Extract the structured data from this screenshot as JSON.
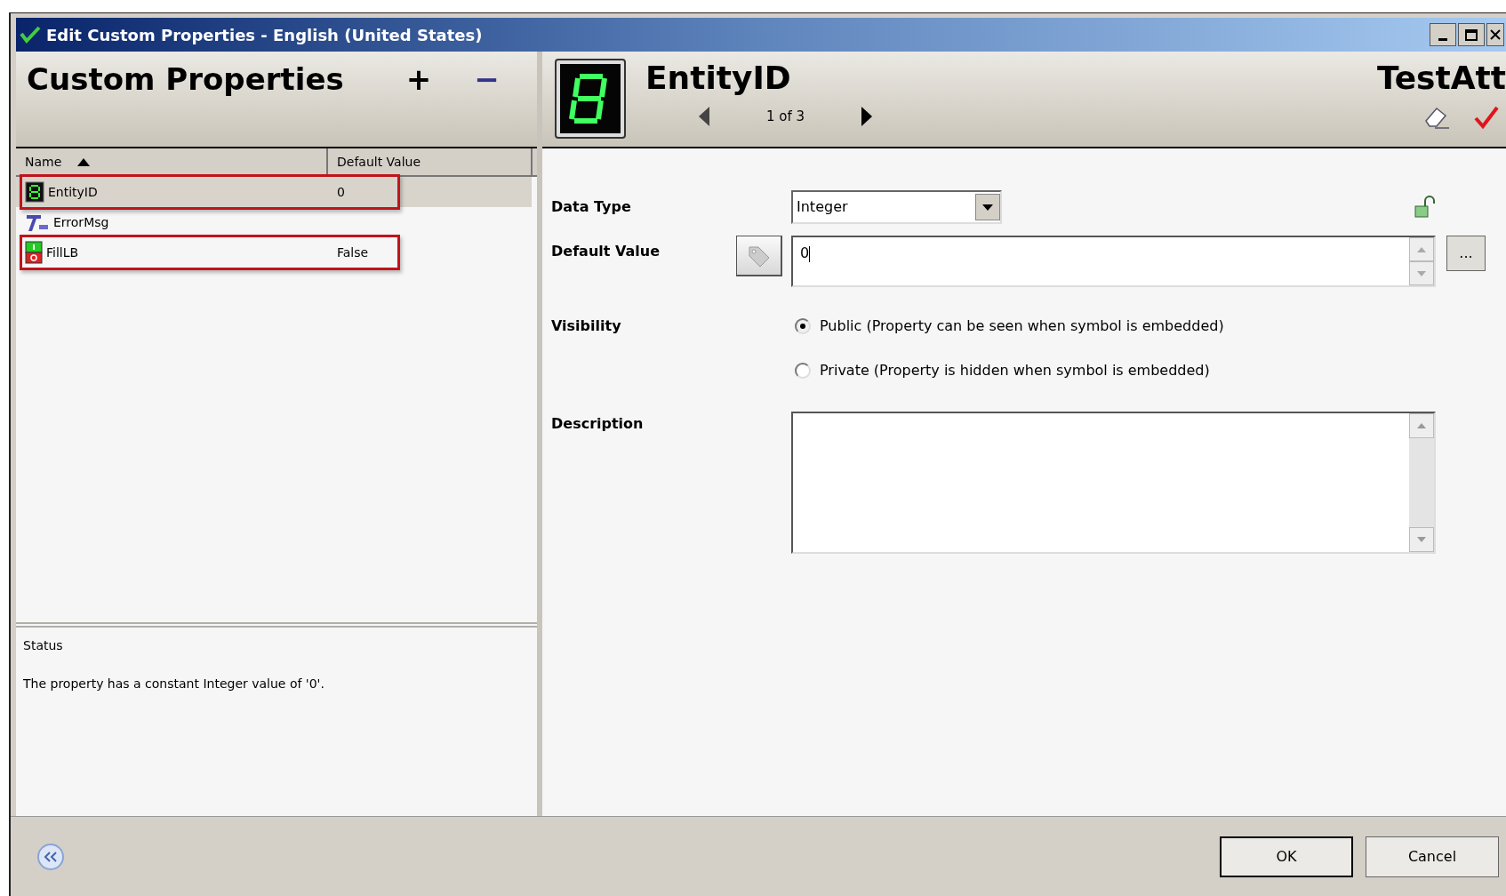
{
  "window": {
    "title": "Edit Custom Properties - English (United States)"
  },
  "left_panel": {
    "title": "Custom Properties",
    "add_label": "+",
    "remove_label": "−",
    "columns": [
      "Name",
      "Default Value"
    ],
    "rows": [
      {
        "kind": "digit",
        "name": "EntityID",
        "value": "0",
        "selected": true,
        "highlighted": true
      },
      {
        "kind": "text",
        "name": "ErrorMsg",
        "selected": false,
        "highlighted": false
      },
      {
        "kind": "boolean",
        "name": "FillLB",
        "value": "False",
        "selected": false,
        "highlighted": true
      }
    ],
    "status": {
      "title": "Status",
      "message": "The property has a constant Integer value of '0'."
    }
  },
  "detail": {
    "name": "EntityID",
    "counter": "1 of 3",
    "symbol": "TestAtt",
    "data_type": {
      "label": "Data Type",
      "value": "Integer"
    },
    "default_value": {
      "label": "Default Value",
      "value": "0",
      "browse_label": "..."
    },
    "visibility": {
      "label": "Visibility",
      "options": [
        {
          "label": "Public (Property can be seen when symbol is embedded)",
          "selected": true
        },
        {
          "label": "Private (Property is hidden when symbol is embedded)",
          "selected": false
        }
      ]
    },
    "description": {
      "label": "Description"
    }
  },
  "buttons": [
    "OK",
    "Cancel"
  ]
}
